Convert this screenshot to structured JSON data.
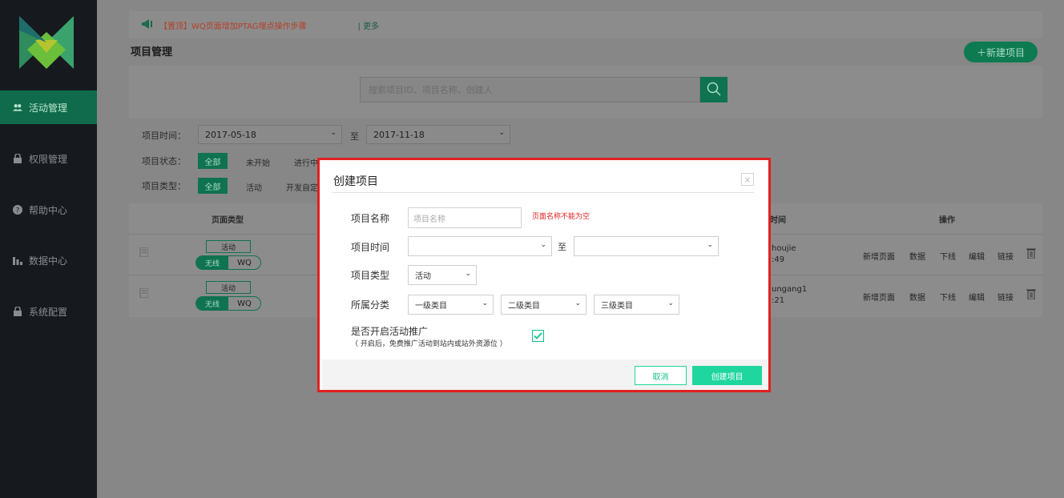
{
  "sidebar": {
    "items": [
      {
        "label": "活动管理",
        "icon": "users-icon",
        "active": true
      },
      {
        "label": "权限管理",
        "icon": "lock-icon"
      },
      {
        "label": "帮助中心",
        "icon": "question-icon"
      },
      {
        "label": "数据中心",
        "icon": "bar-chart-icon"
      },
      {
        "label": "系统配置",
        "icon": "lock-icon"
      }
    ]
  },
  "notice": {
    "tag": "【置顶】",
    "text": "WQ页面增加PTAG埋点操作步骤",
    "more": "| 更多"
  },
  "page": {
    "title": "项目管理",
    "new_button": "＋新建项目"
  },
  "search": {
    "placeholder": "搜索项目ID、项目名称、创建人"
  },
  "filters": {
    "time_label": "项目时间：",
    "start_date": "2017-05-18",
    "to": "至",
    "end_date": "2017-11-18",
    "status_label": "项目状态：",
    "status_options": [
      "全部",
      "未开始",
      "进行中"
    ],
    "type_label": "项目类型：",
    "type_options": [
      "全部",
      "活动",
      "开发自定"
    ]
  },
  "table": {
    "headers": {
      "page_type": "页面类型",
      "time": "时间",
      "actions": "操作"
    },
    "rows": [
      {
        "type": "活动",
        "toggle_a": "无线",
        "toggle_b": "WQ",
        "creator": "houjie",
        "time": ":49"
      },
      {
        "type": "活动",
        "toggle_a": "无线",
        "toggle_b": "WQ",
        "creator": "ungang1",
        "time": ":21"
      }
    ],
    "actions": [
      "新增页面",
      "数据",
      "下线",
      "编辑",
      "链接"
    ]
  },
  "modal": {
    "title": "创建项目",
    "close": "×",
    "name_label": "项目名称",
    "name_placeholder": "项目名称",
    "name_error": "页面名称不能为空",
    "time_label": "项目时间",
    "to": "至",
    "type_label": "项目类型",
    "type_value": "活动",
    "category_label": "所属分类",
    "category1": "一级类目",
    "category2": "二级类目",
    "category3": "三级类目",
    "promo_label": "是否开启活动推广",
    "promo_hint": "（ 开启后，免费推广活动到站内或站外资源位 ）",
    "promo_checked": true,
    "cancel": "取消",
    "create": "创建项目"
  },
  "colors": {
    "accent": "#1ed69e",
    "error": "#e02020",
    "sidebar": "#161a1e"
  }
}
